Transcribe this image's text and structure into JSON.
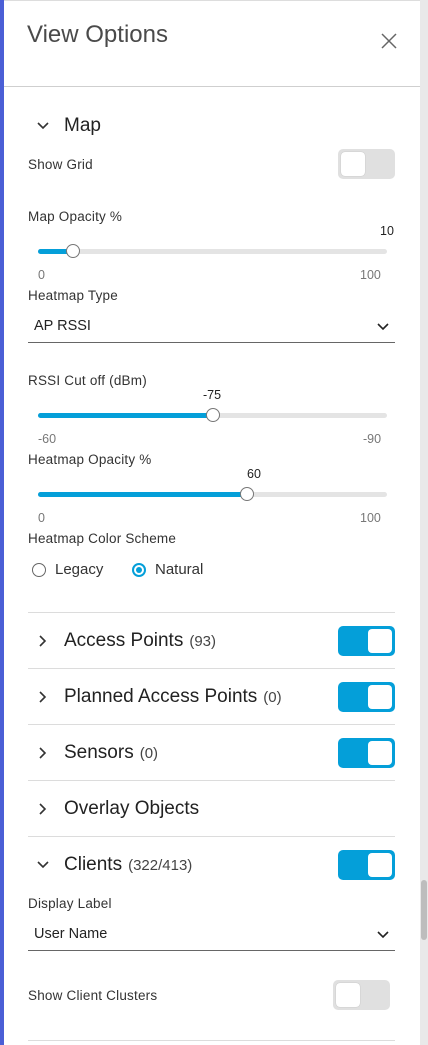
{
  "header": {
    "title": "View Options"
  },
  "map": {
    "title": "Map",
    "show_grid": {
      "label": "Show Grid",
      "on": false
    },
    "opacity": {
      "label": "Map Opacity %",
      "value": "10",
      "min": "0",
      "max": "100",
      "fraction": 0.1
    },
    "heatmap_type": {
      "label": "Heatmap Type",
      "value": "AP RSSI"
    },
    "rssi_cutoff": {
      "label": "RSSI Cut off (dBm)",
      "value": "-75",
      "min": "-60",
      "max": "-90",
      "fraction": 0.5
    },
    "heatmap_opacity": {
      "label": "Heatmap Opacity %",
      "value": "60",
      "min": "0",
      "max": "100",
      "fraction": 0.6
    },
    "color_scheme": {
      "label": "Heatmap Color Scheme",
      "options": [
        "Legacy",
        "Natural"
      ],
      "selected": "Natural"
    }
  },
  "sections": {
    "access_points": {
      "title": "Access Points",
      "count": "(93)",
      "on": true
    },
    "planned_access_points": {
      "title": "Planned Access Points",
      "count": "(0)",
      "on": true
    },
    "sensors": {
      "title": "Sensors",
      "count": "(0)",
      "on": true
    },
    "overlay_objects": {
      "title": "Overlay Objects"
    },
    "clients": {
      "title": "Clients",
      "count": "(322/413)",
      "on": true
    }
  },
  "clients": {
    "display_label": {
      "label": "Display Label",
      "value": "User Name"
    },
    "show_clusters": {
      "label": "Show Client Clusters",
      "on": false
    }
  },
  "colors": {
    "accent": "#049fd9",
    "left_bar": "#4b5fd6"
  }
}
